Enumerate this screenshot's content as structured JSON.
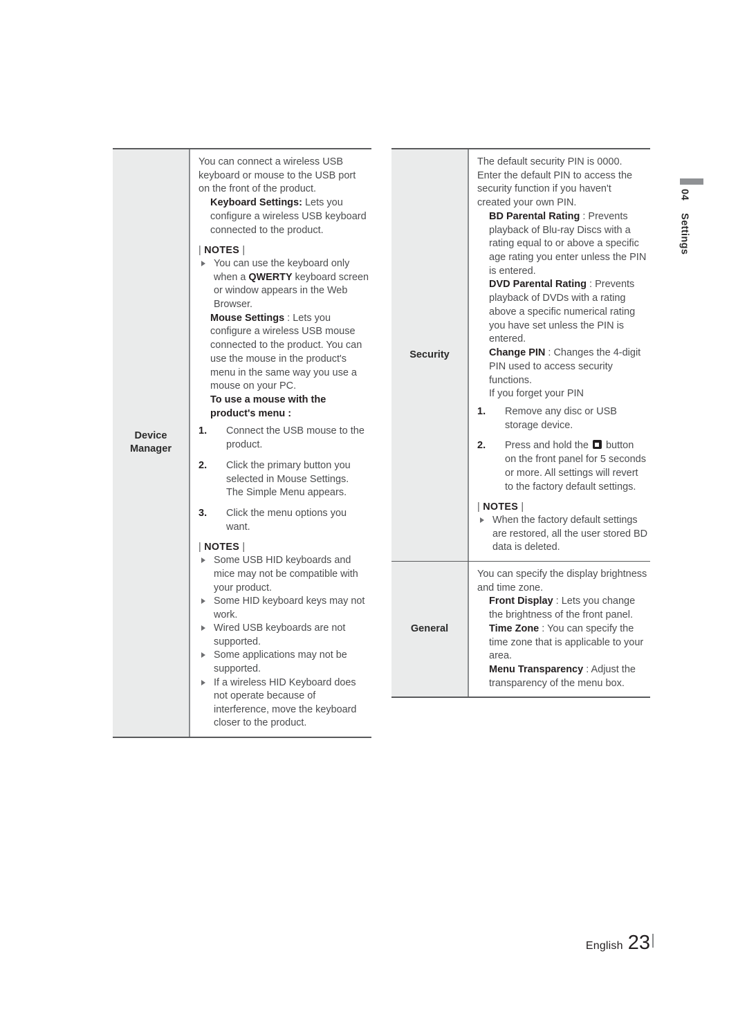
{
  "chapter_tab": {
    "number": "04",
    "name": "Settings",
    "bar_color": "#8f9194"
  },
  "footer": {
    "language": "English",
    "page": "23"
  },
  "notes_label": "NOTES",
  "left_table": {
    "category": "Device\nManager",
    "category_line1": "Device",
    "category_line2": "Manager",
    "intro": "You can connect a wireless USB keyboard or mouse to the USB port on the front of the product.",
    "keyboard_settings_term": "Keyboard Settings:",
    "keyboard_settings_desc": " Lets you configure a wireless USB keyboard connected to the product.",
    "notes_1": [
      {
        "pre": "You can use the keyboard only when a ",
        "bold": "QWERTY",
        "post": " keyboard screen or window appears in the Web Browser."
      }
    ],
    "mouse_settings_term": "Mouse Settings",
    "mouse_settings_desc": " : Lets you configure a wireless USB mouse connected to the product. You can use the mouse in the product's menu in the same way you use a mouse on your PC.",
    "mouse_procedure_heading": "To use a mouse with the product's menu :",
    "steps": [
      {
        "num": "1.",
        "text": "Connect the USB mouse to the product."
      },
      {
        "num": "2.",
        "text": "Click the primary button you selected in Mouse Settings. The Simple Menu appears."
      },
      {
        "num": "3.",
        "text": "Click the menu options you want."
      }
    ],
    "notes_2": [
      "Some USB HID keyboards and mice may not be compatible with your product.",
      "Some HID keyboard keys may not work.",
      "Wired USB keyboards are not supported.",
      "Some applications may not be supported.",
      "If a wireless HID Keyboard does not operate because of interference, move the keyboard closer to the product."
    ]
  },
  "right_table": {
    "security": {
      "category": "Security",
      "intro": "The default security PIN is 0000. Enter the default PIN to access the security function if you haven't created your own PIN.",
      "bd_parental_term": "BD Parental Rating",
      "bd_parental_desc": " : Prevents playback of Blu-ray Discs with a rating equal to or above a specific age rating you enter unless the PIN is entered.",
      "dvd_parental_term": "DVD Parental Rating",
      "dvd_parental_desc": " : Prevents playback of DVDs with a rating above a specific numerical rating you have set unless the PIN is entered.",
      "change_pin_term": "Change PIN",
      "change_pin_desc": " : Changes the 4-digit PIN used to access security functions.",
      "forgot_pin_line": "If you forget your PIN",
      "steps": [
        {
          "num": "1.",
          "text": "Remove any disc or USB storage device."
        },
        {
          "num": "2.",
          "text_before_icon": "Press and hold the ",
          "icon": "stop-button-icon",
          "text_after_icon": " button on the front panel for 5 seconds or more. All settings will revert to the factory default settings."
        }
      ],
      "notes": [
        "When the factory default settings are restored, all the user stored BD data is deleted."
      ]
    },
    "general": {
      "category": "General",
      "intro": "You can specify the display brightness and time zone.",
      "front_display_term": "Front Display",
      "front_display_desc": " : Lets you change the brightness of the front panel.",
      "time_zone_term": "Time Zone",
      "time_zone_desc": " : You can specify the time zone that is applicable to your area.",
      "menu_transparency_term": "Menu Transparency",
      "menu_transparency_desc": " : Adjust the transparency of the menu box."
    }
  }
}
